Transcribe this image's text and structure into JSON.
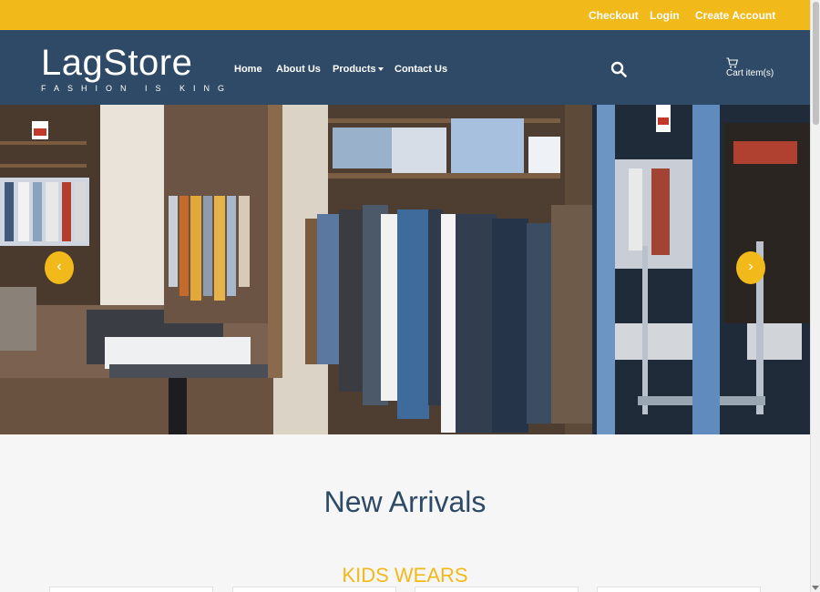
{
  "topbar": {
    "checkout": "Checkout",
    "login": "Login",
    "create_account": "Create Account"
  },
  "brand": {
    "name": "LagStore",
    "tagline": "FASHION IS KING"
  },
  "nav": {
    "home": "Home",
    "about": "About Us",
    "products": "Products",
    "contact": "Contact Us"
  },
  "cart": {
    "label": "Cart item(s)"
  },
  "carousel": {
    "prev": "‹",
    "next": "›"
  },
  "main": {
    "heading": "New Arrivals",
    "category": "KIDS WEARS"
  },
  "colors": {
    "accent": "#f2b91b",
    "navy": "#2e4a66"
  }
}
